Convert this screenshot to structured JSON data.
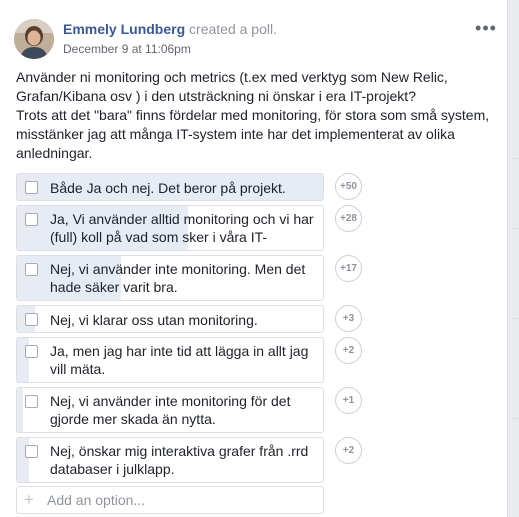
{
  "post": {
    "author_name": "Emmely Lundberg",
    "action": "created a poll.",
    "timestamp": "December 9 at 11:06pm",
    "menu_icon": "more-horizontal-icon",
    "menu_label": "•••",
    "text": [
      "Använder ni monitoring och metrics (t.ex med verktyg som New Relic, Grafan/Kibana osv ) i den utsträckning ni önskar i era IT-projekt?",
      "Trots att det \"bara\" finns fördelar med monitoring, för stora som små system, misstänker jag att många IT-system inte har det implementerat av olika anledningar."
    ]
  },
  "poll": {
    "options": [
      {
        "label": "Både Ja och nej. Det beror på projekt.",
        "count": "+50",
        "share": 1.0
      },
      {
        "label": "Ja, Vi använder alltid monitoring och vi har (full) koll på vad som sker i våra IT-system.",
        "count": "+28",
        "share": 0.56
      },
      {
        "label": "Nej, vi använder inte monitoring. Men det hade säker varit bra.",
        "count": "+17",
        "share": 0.34
      },
      {
        "label": "Nej, vi klarar oss utan monitoring.",
        "count": "+3",
        "share": 0.06
      },
      {
        "label": "Ja, men jag har inte tid att lägga in allt jag vill mäta.",
        "count": "+2",
        "share": 0.04
      },
      {
        "label": "Nej, vi använder inte monitoring för det gjorde mer skada än nytta.",
        "count": "+1",
        "share": 0.02
      },
      {
        "label": "Nej, önskar mig interaktiva grafer från .rrd databaser i julklapp.",
        "count": "+2",
        "share": 0.04
      }
    ],
    "add_option_placeholder": "Add an option...",
    "add_icon": "plus-icon",
    "add_icon_glyph": "+"
  }
}
